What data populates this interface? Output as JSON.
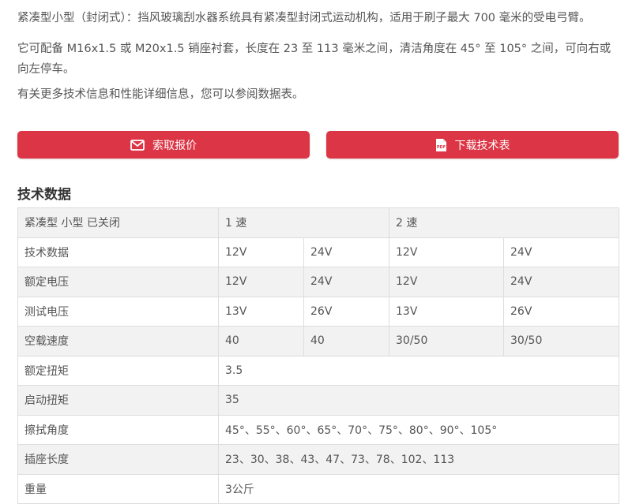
{
  "intro": {
    "p1": "紧凑型小型（封闭式）：挡风玻璃刮水器系统具有紧凑型封闭式运动机构，适用于刷子最大 700 毫米的受电弓臂。",
    "p2": "它可配备 M16x1.5 或 M20x1.5 销座衬套，长度在 23 至 113 毫米之间，清洁角度在 45° 至 105° 之间，可向右或向左停车。",
    "p3": "有关更多技术信息和性能详细信息，您可以参阅数据表。"
  },
  "buttons": {
    "quote": {
      "label": "索取报价",
      "icon": "envelope-icon"
    },
    "datasheet": {
      "label": "下载技术表",
      "icon": "pdf-icon"
    }
  },
  "colors": {
    "accent": "#dc3545",
    "row_alt": "#f2f2f2",
    "border": "#dddddd"
  },
  "section_title": "技术数据",
  "table": {
    "header": {
      "label": "紧凑型 小型 已关闭",
      "speed1": "1 速",
      "speed2": "2 速"
    },
    "rows": [
      {
        "label": "技术数据",
        "c1": "12V",
        "c2": "24V",
        "c3": "12V",
        "c4": "24V"
      },
      {
        "label": "额定电压",
        "c1": "12V",
        "c2": "24V",
        "c3": "12V",
        "c4": "24V"
      },
      {
        "label": "测试电压",
        "c1": "13V",
        "c2": "26V",
        "c3": "13V",
        "c4": "26V"
      },
      {
        "label": "空载速度",
        "c1": "40",
        "c2": "40",
        "c3": "30/50",
        "c4": "30/50"
      },
      {
        "label": "额定扭矩",
        "value": "3.5"
      },
      {
        "label": "启动扭矩",
        "value": "35"
      },
      {
        "label": "擦拭角度",
        "value": "45°、55°、60°、65°、70°、75°、80°、90°、105°"
      },
      {
        "label": "插座长度",
        "value": "23、30、38、43、47、73、78、102、113"
      },
      {
        "label": "重量",
        "value": "3公斤"
      }
    ]
  }
}
